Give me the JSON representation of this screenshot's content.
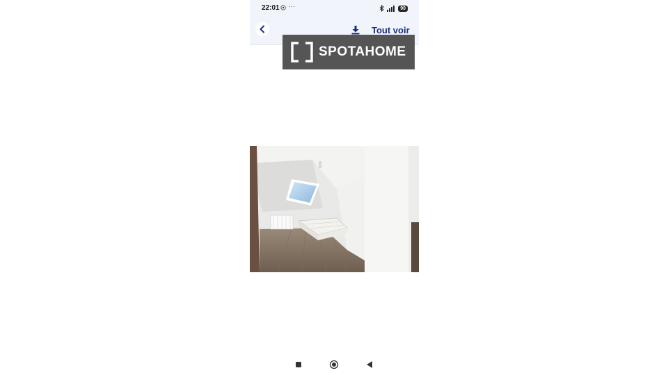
{
  "status_bar": {
    "time": "22:01",
    "more_indicator": "···",
    "battery": "90",
    "icons": [
      "whatsapp-icon",
      "bluetooth-icon",
      "signal-icon",
      "battery-icon"
    ]
  },
  "app_bar": {
    "back_icon": "chevron-left-icon",
    "download_icon": "download-icon",
    "see_all_label": "Tout voir",
    "accent_color": "#1a2f7a"
  },
  "watermark": {
    "brand": "SPOTAHOME",
    "icon": "spotahome-bracket-icon",
    "background": "#555555"
  },
  "photo": {
    "subject": "attic bedroom with skylight, bed frame, radiator and wood floor"
  },
  "nav_bar": {
    "icons": [
      "recent-apps-icon",
      "home-icon",
      "back-icon"
    ]
  }
}
